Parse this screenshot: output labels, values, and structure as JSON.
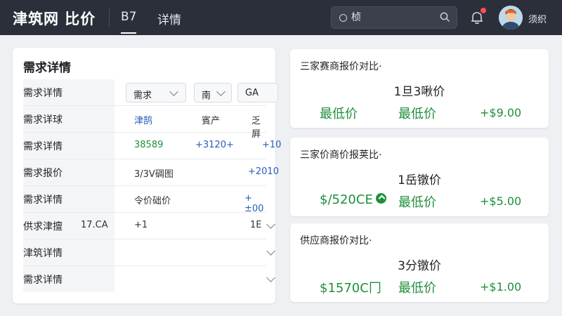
{
  "header": {
    "brand": "津筑网 比价",
    "tabs": [
      "B7",
      "详情"
    ],
    "search": {
      "value": "",
      "placeholder": "桢"
    },
    "user_name": "须织"
  },
  "left_panel": {
    "title": "需求详情",
    "rows": [
      {
        "label": "需求详情",
        "select1": "需求",
        "select2": "南",
        "select3": "GA"
      },
      {
        "label": "需求详球",
        "c1": "津鹄",
        "c2": "賓产",
        "c3": "乏屛"
      },
      {
        "label": "需求详情",
        "c1": "38589",
        "c2": "+3120+",
        "c3": "+10"
      },
      {
        "label": "需求报价",
        "c1": "3/3V碉图",
        "c3": "+2010"
      },
      {
        "label": "需求详情",
        "c1": "令价础价",
        "c3": "+±00"
      },
      {
        "label": "供求津擅",
        "c0": "17.CA",
        "c1": "+1",
        "c3": "1E"
      },
      {
        "label": "津筑详情"
      },
      {
        "label": "需求详情"
      }
    ]
  },
  "cards": [
    {
      "title": "三家赛商报价对比·",
      "subtitle": "1旦3啾价",
      "v1": "最低价",
      "v2": "最低价",
      "v3": "+$9.00"
    },
    {
      "title": "三家价商价报荚比·",
      "subtitle": "1岳镦价",
      "v1": "$/520CE",
      "v2": "最低价",
      "v3": "+$5.00"
    },
    {
      "title": "供应商报价对比·",
      "subtitle": "3分镦价",
      "v1": "$1570C冂",
      "v2": "最低价",
      "v3": "+$1.00"
    }
  ],
  "colors": {
    "topbar": "#2b2f3a",
    "accent_green": "#1f8f3a",
    "accent_blue": "#2a5cb8",
    "notify_red": "#ff4d4f"
  }
}
